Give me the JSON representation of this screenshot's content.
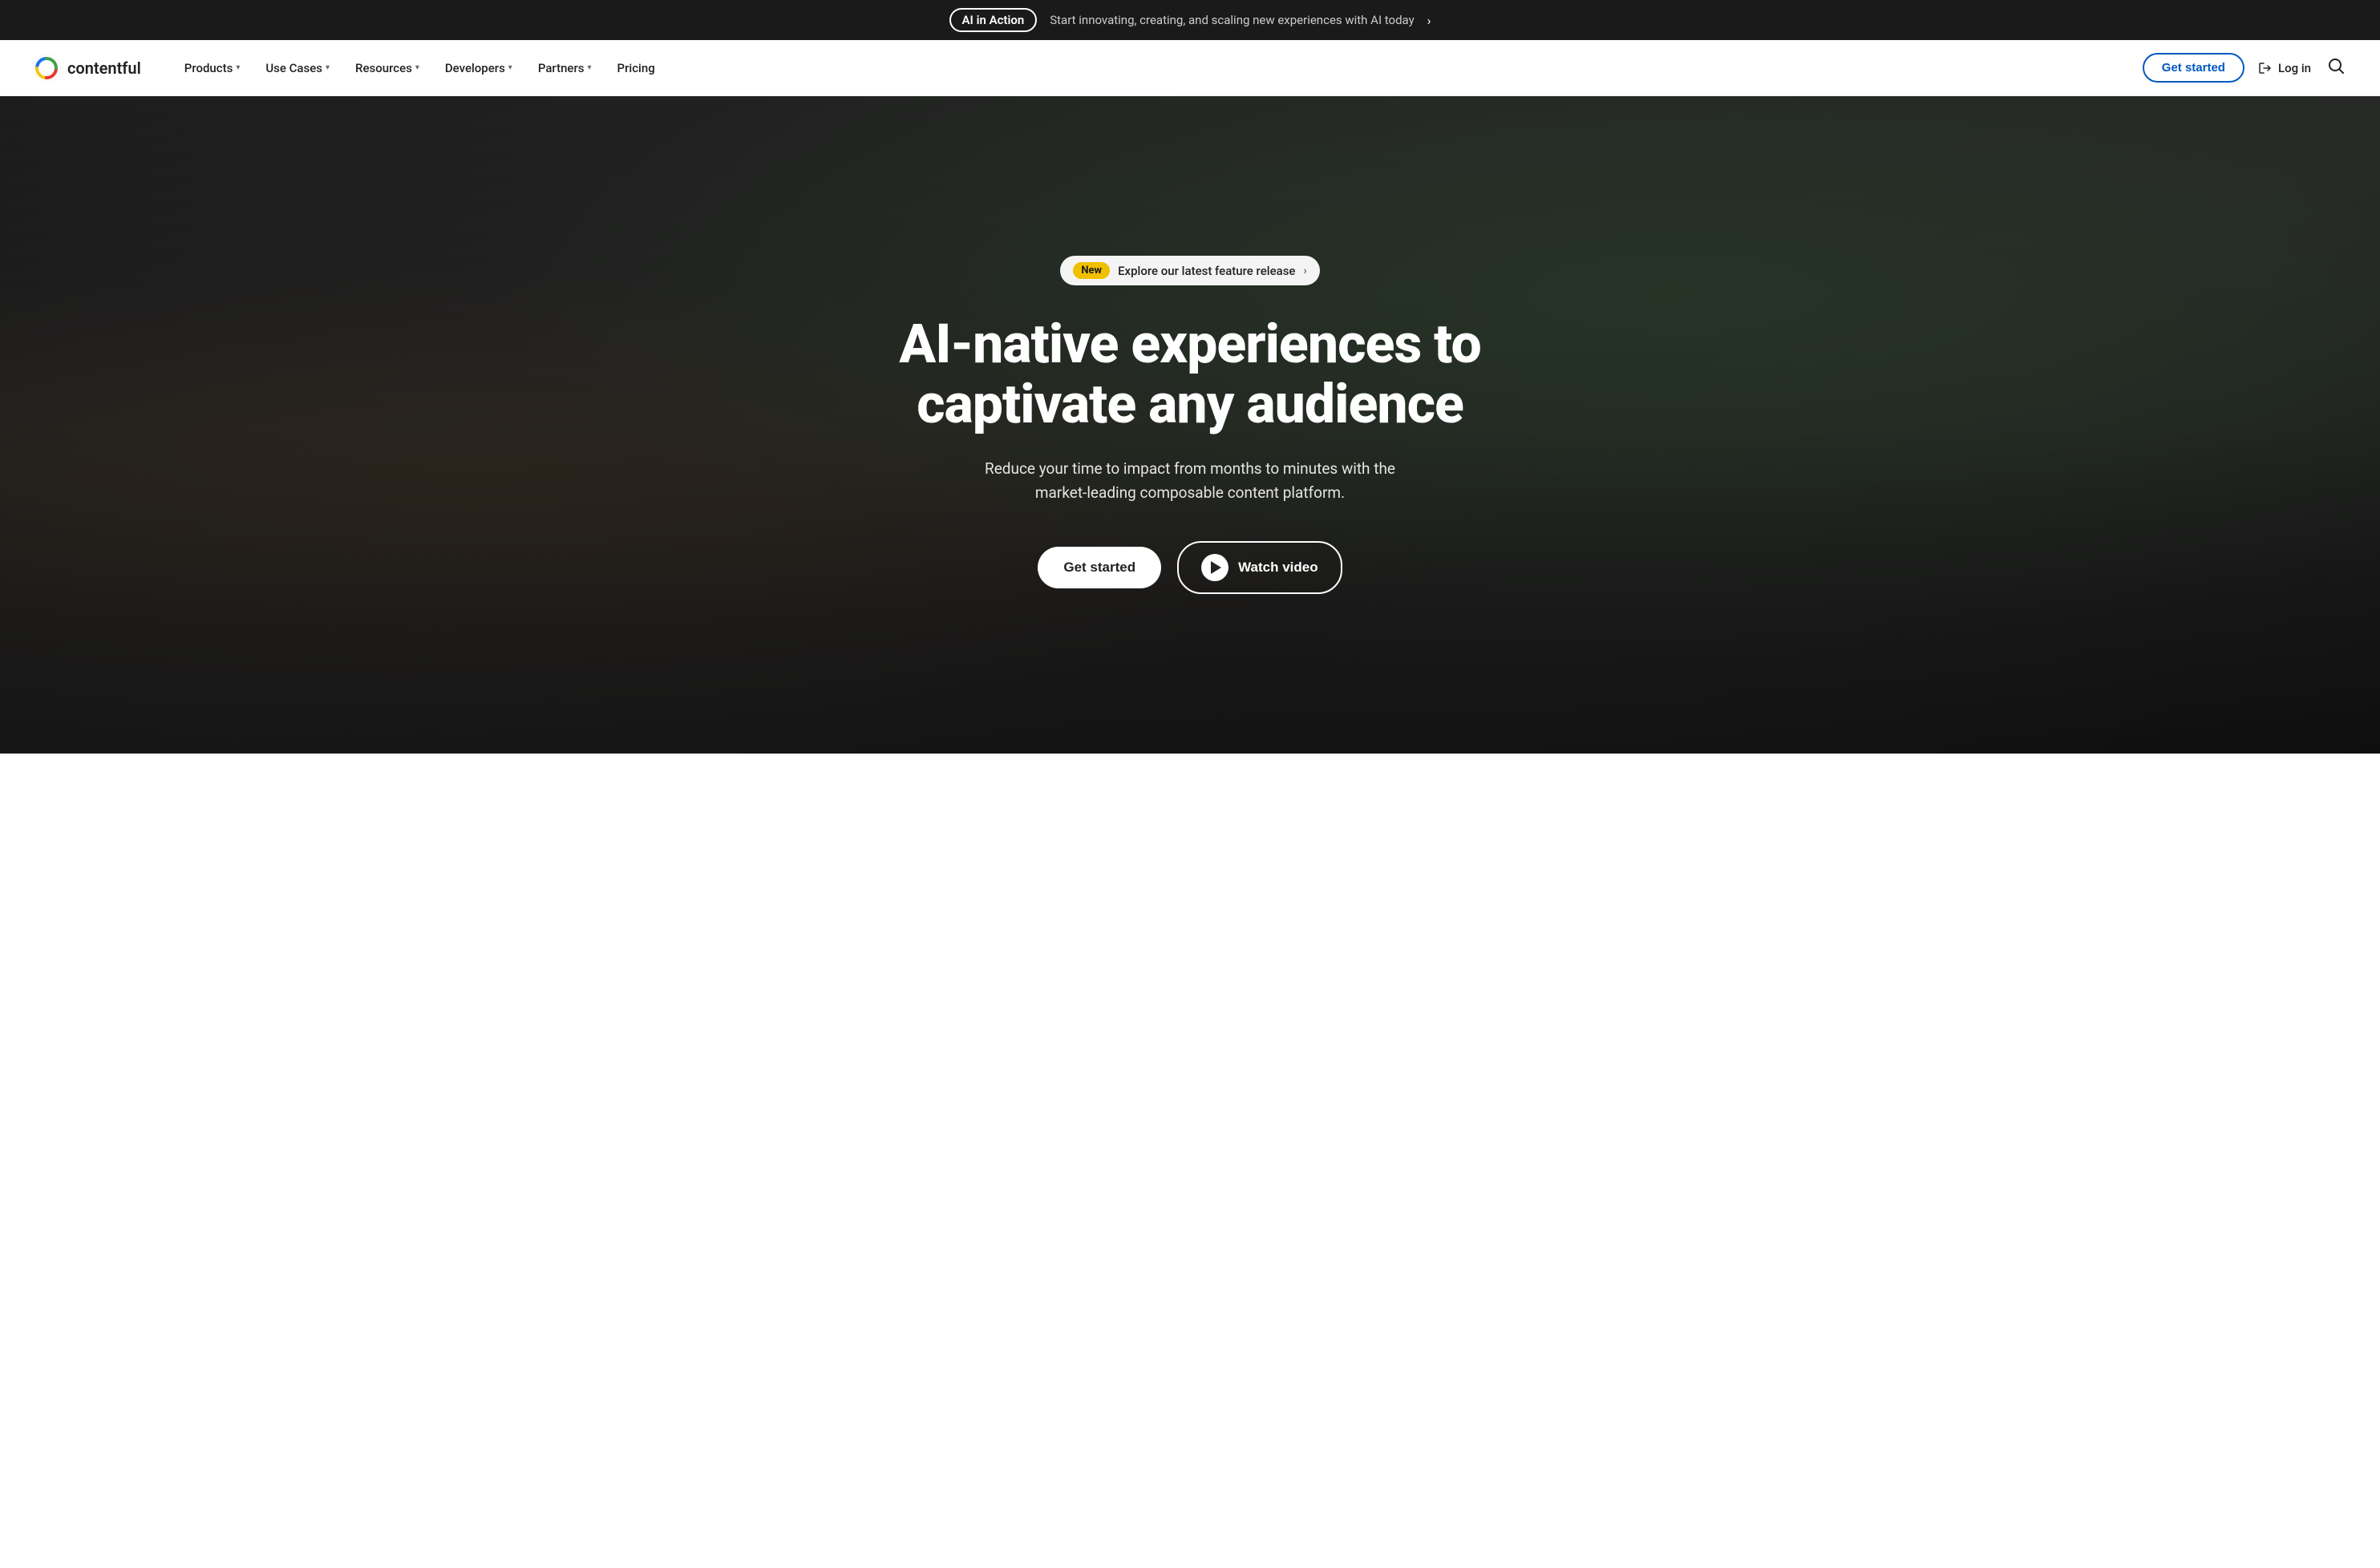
{
  "banner": {
    "badge_label": "AI in Action",
    "text": "Start innovating, creating, and scaling new experiences with AI today",
    "arrow": "›"
  },
  "header": {
    "logo_text": "contentful",
    "nav_items": [
      {
        "label": "Products",
        "has_dropdown": true
      },
      {
        "label": "Use Cases",
        "has_dropdown": true
      },
      {
        "label": "Resources",
        "has_dropdown": true
      },
      {
        "label": "Developers",
        "has_dropdown": true
      },
      {
        "label": "Partners",
        "has_dropdown": true
      },
      {
        "label": "Pricing",
        "has_dropdown": false
      }
    ],
    "get_started_label": "Get started",
    "login_label": "Log in"
  },
  "hero": {
    "new_badge": "New",
    "new_badge_text": "Explore our latest feature release",
    "new_badge_arrow": "›",
    "title": "AI-native experiences to captivate any audience",
    "subtitle": "Reduce your time to impact from months to minutes with the market-leading composable content platform.",
    "cta_primary": "Get started",
    "cta_video": "Watch video"
  }
}
